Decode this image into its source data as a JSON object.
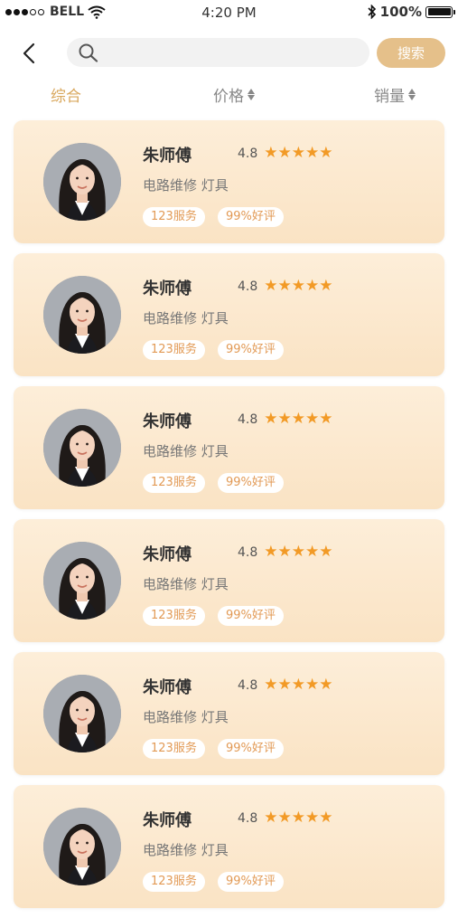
{
  "status_bar": {
    "carrier": "BELL",
    "time": "4:20 PM",
    "battery": "100%"
  },
  "search": {
    "placeholder": "",
    "button_label": "搜索"
  },
  "tabs": [
    {
      "label": "综合",
      "active": true
    },
    {
      "label": "价格",
      "sortable": true
    },
    {
      "label": "销量",
      "sortable": true
    }
  ],
  "accent_color": "#e5c08a",
  "star_color": "#f29a26",
  "workers": [
    {
      "name": "朱师傅",
      "rating": "4.8",
      "stars": 5,
      "skills": "电路维修 灯具",
      "services": "123服务",
      "praise": "99%好评"
    },
    {
      "name": "朱师傅",
      "rating": "4.8",
      "stars": 5,
      "skills": "电路维修 灯具",
      "services": "123服务",
      "praise": "99%好评"
    },
    {
      "name": "朱师傅",
      "rating": "4.8",
      "stars": 5,
      "skills": "电路维修 灯具",
      "services": "123服务",
      "praise": "99%好评"
    },
    {
      "name": "朱师傅",
      "rating": "4.8",
      "stars": 5,
      "skills": "电路维修 灯具",
      "services": "123服务",
      "praise": "99%好评"
    },
    {
      "name": "朱师傅",
      "rating": "4.8",
      "stars": 5,
      "skills": "电路维修 灯具",
      "services": "123服务",
      "praise": "99%好评"
    },
    {
      "name": "朱师傅",
      "rating": "4.8",
      "stars": 5,
      "skills": "电路维修 灯具",
      "services": "123服务",
      "praise": "99%好评"
    }
  ]
}
